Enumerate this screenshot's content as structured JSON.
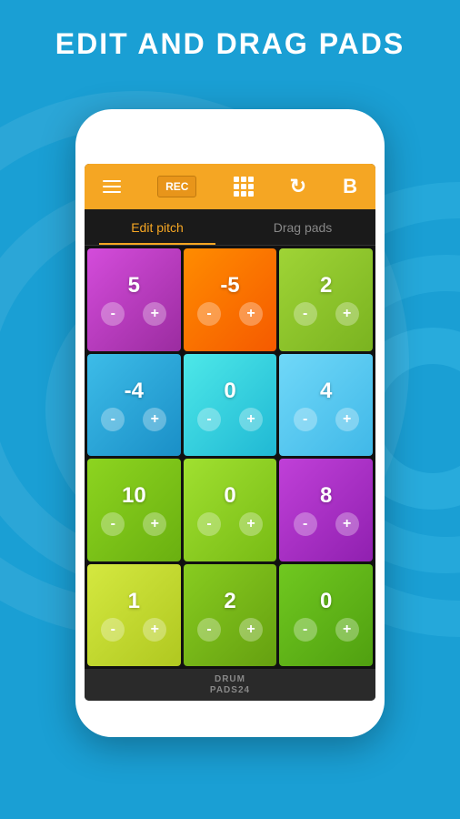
{
  "page": {
    "title": "EDIT AND DRAG PADS",
    "background_color": "#1a9fd4"
  },
  "toolbar": {
    "rec_label": "REC",
    "refresh_icon": "↻",
    "b_label": "B"
  },
  "tabs": {
    "active": "Edit pitch",
    "inactive": "Drag pads"
  },
  "pads": [
    {
      "value": "5",
      "color": "pad-purple",
      "row": 1,
      "col": 1
    },
    {
      "value": "-5",
      "color": "pad-orange",
      "row": 1,
      "col": 2
    },
    {
      "value": "2",
      "color": "pad-lime",
      "row": 1,
      "col": 3
    },
    {
      "value": "-4",
      "color": "pad-blue",
      "row": 2,
      "col": 1
    },
    {
      "value": "0",
      "color": "pad-cyan",
      "row": 2,
      "col": 2
    },
    {
      "value": "4",
      "color": "pad-light-blue",
      "row": 2,
      "col": 3
    },
    {
      "value": "10",
      "color": "pad-green",
      "row": 3,
      "col": 1
    },
    {
      "value": "0",
      "color": "pad-green2",
      "row": 3,
      "col": 2
    },
    {
      "value": "8",
      "color": "pad-purple2",
      "row": 3,
      "col": 3
    },
    {
      "value": "1",
      "color": "pad-yellow-green",
      "row": 4,
      "col": 1
    },
    {
      "value": "2",
      "color": "pad-green3",
      "row": 4,
      "col": 2
    },
    {
      "value": "0",
      "color": "pad-green4",
      "row": 4,
      "col": 3
    }
  ],
  "bottom": {
    "brand_line1": "DRUM",
    "brand_line2": "PADS24"
  }
}
